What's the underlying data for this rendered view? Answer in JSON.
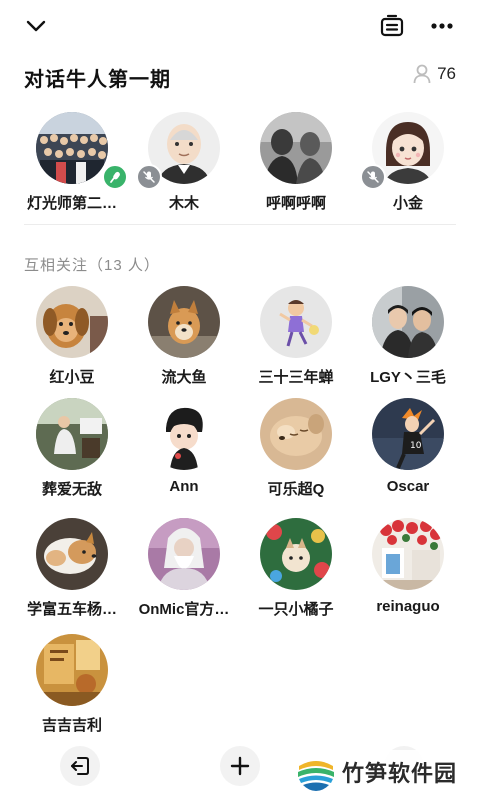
{
  "room": {
    "title": "对话牛人第一期",
    "listener_count": "76"
  },
  "icons": {
    "collapse": "chevron-down-icon",
    "notes": "note-icon",
    "more": "more-dots-icon",
    "listeners": "person-icon",
    "leave": "exit-icon",
    "add": "plus-icon"
  },
  "speakers": [
    {
      "name": "灯光师第二…",
      "mic": "on"
    },
    {
      "name": "木木",
      "mic": "off"
    },
    {
      "name": "呼啊呼啊",
      "mic": "none"
    },
    {
      "name": "小金",
      "mic": "off"
    }
  ],
  "section": {
    "label": "互相关注（13 人）"
  },
  "friends": [
    {
      "name": "红小豆"
    },
    {
      "name": "流大鱼"
    },
    {
      "name": "三十三年蝉"
    },
    {
      "name": "LGY丶三毛"
    },
    {
      "name": "葬爱无敌"
    },
    {
      "name": "Ann"
    },
    {
      "name": "可乐超Q"
    },
    {
      "name": "Oscar"
    },
    {
      "name": "学富五车杨…"
    },
    {
      "name": "OnMic官方…"
    },
    {
      "name": "一只小橘子"
    },
    {
      "name": "reinaguo"
    },
    {
      "name": "吉吉吉利"
    }
  ],
  "watermark": {
    "text": "竹笋软件园"
  },
  "colors": {
    "mic_on": "#39b36a",
    "mic_off": "#8b8f94",
    "section_text": "#8c8c8c"
  }
}
